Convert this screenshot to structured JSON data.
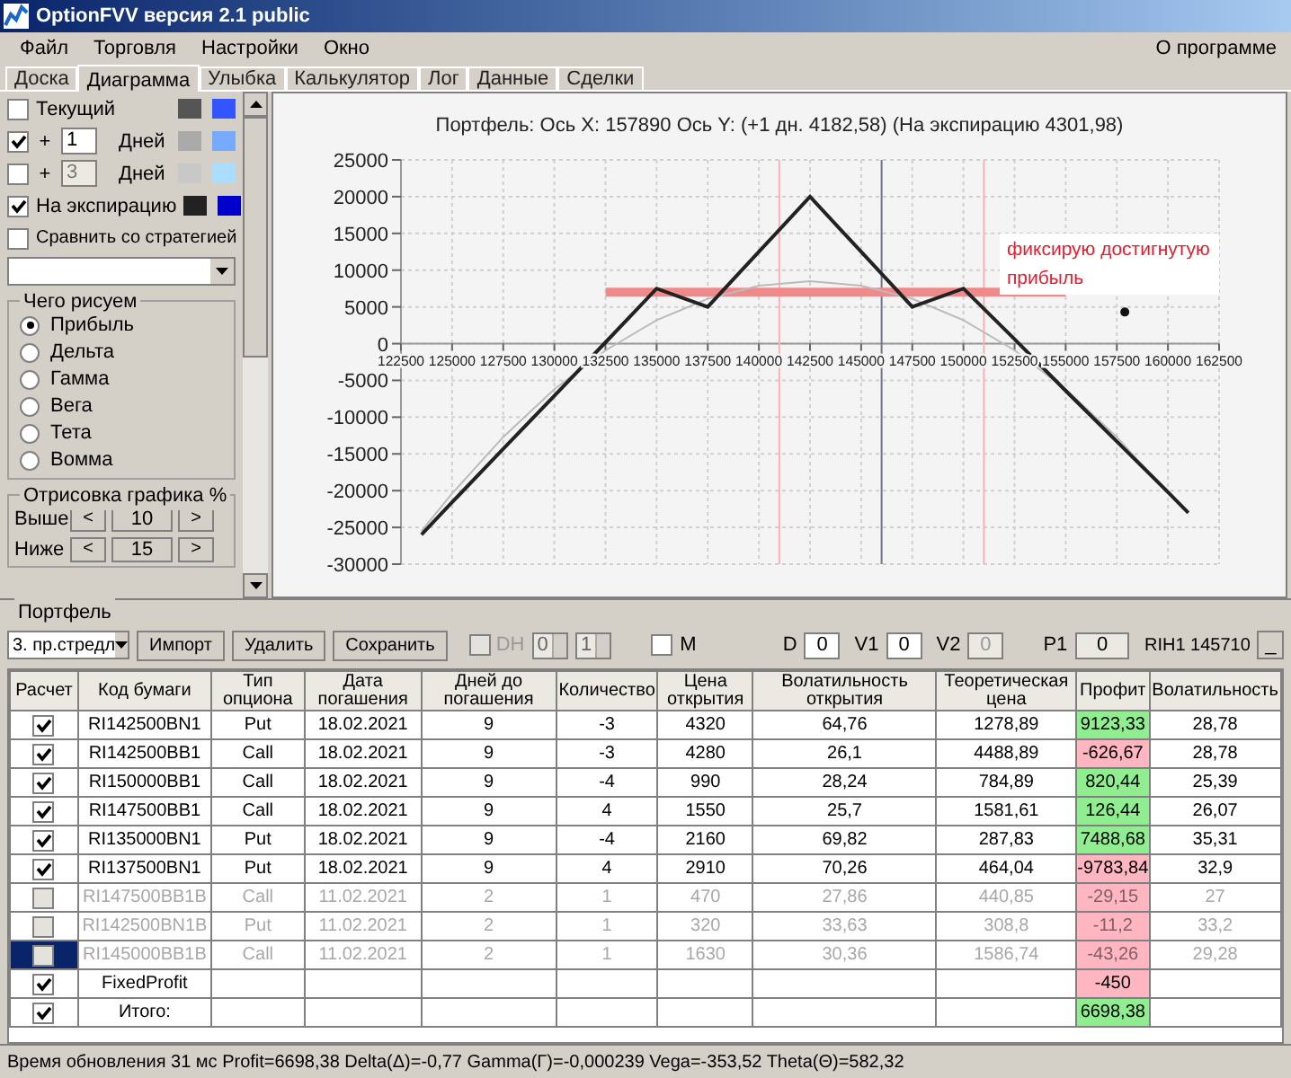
{
  "window": {
    "title": "OptionFVV версия 2.1 public"
  },
  "menu": [
    "Файл",
    "Торговля",
    "Настройки",
    "Окно"
  ],
  "menu_right": "О программе",
  "tabs": [
    {
      "label": "Доска",
      "selected": false
    },
    {
      "label": "Диаграмма",
      "selected": true
    },
    {
      "label": "Улыбка",
      "selected": false
    },
    {
      "label": "Калькулятор",
      "selected": false
    },
    {
      "label": "Лог",
      "selected": false
    },
    {
      "label": "Данные",
      "selected": false
    },
    {
      "label": "Сделки",
      "selected": false
    }
  ],
  "series_options": [
    {
      "kind": "plain",
      "label": "Текущий",
      "checked": false,
      "swatches": [
        {
          "color": "#555555"
        },
        {
          "color": "#3355ff"
        }
      ]
    },
    {
      "kind": "days",
      "prefix": "+",
      "days": "1",
      "label": "Дней",
      "checked": true,
      "swatches": [
        {
          "color": "#aaaaaa"
        },
        {
          "color": "#77aaff"
        }
      ]
    },
    {
      "kind": "days",
      "prefix": "+",
      "days": "3",
      "label": "Дней",
      "checked": false,
      "swatches": [
        {
          "color": "#c8c8c8"
        },
        {
          "color": "#aaddff"
        }
      ]
    },
    {
      "kind": "plain",
      "label": "На экспирацию",
      "checked": true,
      "swatches": [
        {
          "color": "#222222"
        },
        {
          "color": "#0000cc"
        }
      ]
    },
    {
      "kind": "compare",
      "label": "Сравнить со стратегией",
      "checked": false
    }
  ],
  "draw_what": {
    "title": "Чего рисуем",
    "options": [
      {
        "label": "Прибыль",
        "selected": true
      },
      {
        "label": "Дельта",
        "selected": false
      },
      {
        "label": "Гамма",
        "selected": false
      },
      {
        "label": "Вега",
        "selected": false
      },
      {
        "label": "Тета",
        "selected": false
      },
      {
        "label": "Вомма",
        "selected": false
      }
    ]
  },
  "range": {
    "title": "Отрисовка графика %",
    "rows": [
      {
        "label": "Выше",
        "dec": "<",
        "value": "10",
        "inc": ">"
      },
      {
        "label": "Ниже",
        "dec": "<",
        "value": "15",
        "inc": ">"
      }
    ]
  },
  "chart": {
    "chart_data": {
      "type": "line",
      "title": "Портфель: Ось X: 157890 Ось Y:  (+1 дн. 4182,58)  (На экспирацию 4301,98)",
      "x": [
        123500,
        125000,
        127500,
        130000,
        132500,
        135000,
        137500,
        140000,
        142500,
        145000,
        147500,
        150000,
        152500,
        155000,
        157500,
        160000,
        161000
      ],
      "series": [
        {
          "color": "#222222",
          "values": [
            -26000,
            -21600,
            -14300,
            -7100,
            200,
            7500,
            5000,
            12500,
            20000,
            12500,
            5000,
            7500,
            600,
            -6400,
            -13300,
            -20200,
            -23000
          ]
        },
        {
          "color": "#bbbbbb",
          "values": [
            -25500,
            -20400,
            -12700,
            -6200,
            -900,
            3200,
            6100,
            7900,
            8500,
            7900,
            6100,
            3200,
            -900,
            -6200,
            -12700,
            -20400,
            null
          ]
        },
        {
          "color": "#f08a8a",
          "values": [
            null,
            null,
            null,
            null,
            7000,
            7000,
            7000,
            7000,
            7000,
            7000,
            7000,
            7000,
            7000,
            7000,
            null,
            null,
            null
          ]
        }
      ],
      "xlim": [
        122500,
        162500
      ],
      "ylim": [
        -30000,
        25000
      ],
      "grid": true,
      "xticks": [
        122500,
        125000,
        127500,
        130000,
        132500,
        135000,
        137500,
        140000,
        142500,
        145000,
        147500,
        150000,
        152500,
        155000,
        157500,
        160000,
        162500
      ],
      "yticks": [
        -30000,
        -25000,
        -20000,
        -15000,
        -10000,
        -5000,
        0,
        5000,
        10000,
        15000,
        20000,
        25000
      ],
      "ref_lines": [
        {
          "axis": "x",
          "value": 141000,
          "color": "#ffb0b0"
        },
        {
          "axis": "x",
          "value": 151000,
          "color": "#ffb0b0"
        },
        {
          "axis": "x",
          "value": 146000,
          "color": "#6a7a8a"
        }
      ],
      "annotations": [
        {
          "text": "фиксирую достигнутую прибыль"
        }
      ]
    }
  },
  "portfolio": {
    "title": "Портфель",
    "strategy": "3. пр.стредл",
    "buttons": [
      "Импорт",
      "Удалить",
      "Сохранить"
    ],
    "dh": {
      "label": "DH",
      "checked": false,
      "disabled": true
    },
    "spin_1": "0",
    "spin_2": "1",
    "m": {
      "label": "M",
      "checked": false
    },
    "fields": [
      {
        "label": "D",
        "value": "0",
        "disabled": false
      },
      {
        "label": "V1",
        "value": "0",
        "disabled": false
      },
      {
        "label": "V2",
        "value": "0",
        "disabled": true
      }
    ],
    "p1": {
      "label": "P1",
      "value": "0"
    },
    "ticker": "RIH1 145710",
    "mini_button": "_"
  },
  "table": {
    "columns": [
      "Расчет",
      "Код бумаги",
      "Тип опциона",
      "Дата погашения",
      "Дней до погашения",
      "Количество",
      "Цена открытия",
      "Волатильность открытия",
      "Теоретическая цена",
      "Профит",
      "Волатильность"
    ],
    "rows": [
      {
        "checked": true,
        "disabled": false,
        "selected": false,
        "color": "#90ee90",
        "cells": [
          "",
          "RI142500BN1",
          "Put",
          "18.02.2021",
          "9",
          "-3",
          "4320",
          "64,76",
          "1278,89",
          "9123,33",
          "28,78"
        ]
      },
      {
        "checked": true,
        "disabled": false,
        "selected": false,
        "color": "#ffb6c1",
        "cells": [
          "",
          "RI142500BB1",
          "Call",
          "18.02.2021",
          "9",
          "-3",
          "4280",
          "26,1",
          "4488,89",
          "-626,67",
          "28,78"
        ]
      },
      {
        "checked": true,
        "disabled": false,
        "selected": false,
        "color": "#90ee90",
        "cells": [
          "",
          "RI150000BB1",
          "Call",
          "18.02.2021",
          "9",
          "-4",
          "990",
          "28,24",
          "784,89",
          "820,44",
          "25,39"
        ]
      },
      {
        "checked": true,
        "disabled": false,
        "selected": false,
        "color": "#90ee90",
        "cells": [
          "",
          "RI147500BB1",
          "Call",
          "18.02.2021",
          "9",
          "4",
          "1550",
          "25,7",
          "1581,61",
          "126,44",
          "26,07"
        ]
      },
      {
        "checked": true,
        "disabled": false,
        "selected": false,
        "color": "#90ee90",
        "cells": [
          "",
          "RI135000BN1",
          "Put",
          "18.02.2021",
          "9",
          "-4",
          "2160",
          "69,82",
          "287,83",
          "7488,68",
          "35,31"
        ]
      },
      {
        "checked": true,
        "disabled": false,
        "selected": false,
        "color": "#ffb6c1",
        "cells": [
          "",
          "RI137500BN1",
          "Put",
          "18.02.2021",
          "9",
          "4",
          "2910",
          "70,26",
          "464,04",
          "-9783,84",
          "32,9"
        ]
      },
      {
        "checked": false,
        "disabled": true,
        "selected": false,
        "color": "#ffb6c1",
        "cells": [
          "",
          "RI147500BB1B",
          "Call",
          "11.02.2021",
          "2",
          "1",
          "470",
          "27,86",
          "440,85",
          "-29,15",
          "27"
        ]
      },
      {
        "checked": false,
        "disabled": true,
        "selected": false,
        "color": "#ffb6c1",
        "cells": [
          "",
          "RI142500BN1B",
          "Put",
          "11.02.2021",
          "2",
          "1",
          "320",
          "33,63",
          "308,8",
          "-11,2",
          "33,2"
        ]
      },
      {
        "checked": false,
        "disabled": true,
        "selected": true,
        "color": "#ffb6c1",
        "cells": [
          "",
          "RI145000BB1B",
          "Call",
          "11.02.2021",
          "2",
          "1",
          "1630",
          "30,36",
          "1586,74",
          "-43,26",
          "29,28"
        ]
      },
      {
        "checked": true,
        "disabled": false,
        "selected": false,
        "color": "#ffb6c1",
        "cells": [
          "",
          "FixedProfit",
          "",
          "",
          "",
          "",
          "",
          "",
          "",
          "-450",
          ""
        ]
      },
      {
        "checked": true,
        "disabled": false,
        "selected": false,
        "color": "#90ee90",
        "cells": [
          "",
          "Итого:",
          "",
          "",
          "",
          "",
          "",
          "",
          "",
          "6698,38",
          ""
        ]
      }
    ]
  },
  "status_bar": "Время обновления 31 мс  Profit=6698,38 Delta(Δ)=-0,77 Gamma(Γ)=-0,000239 Vega=-353,52 Theta(Θ)=582,32"
}
